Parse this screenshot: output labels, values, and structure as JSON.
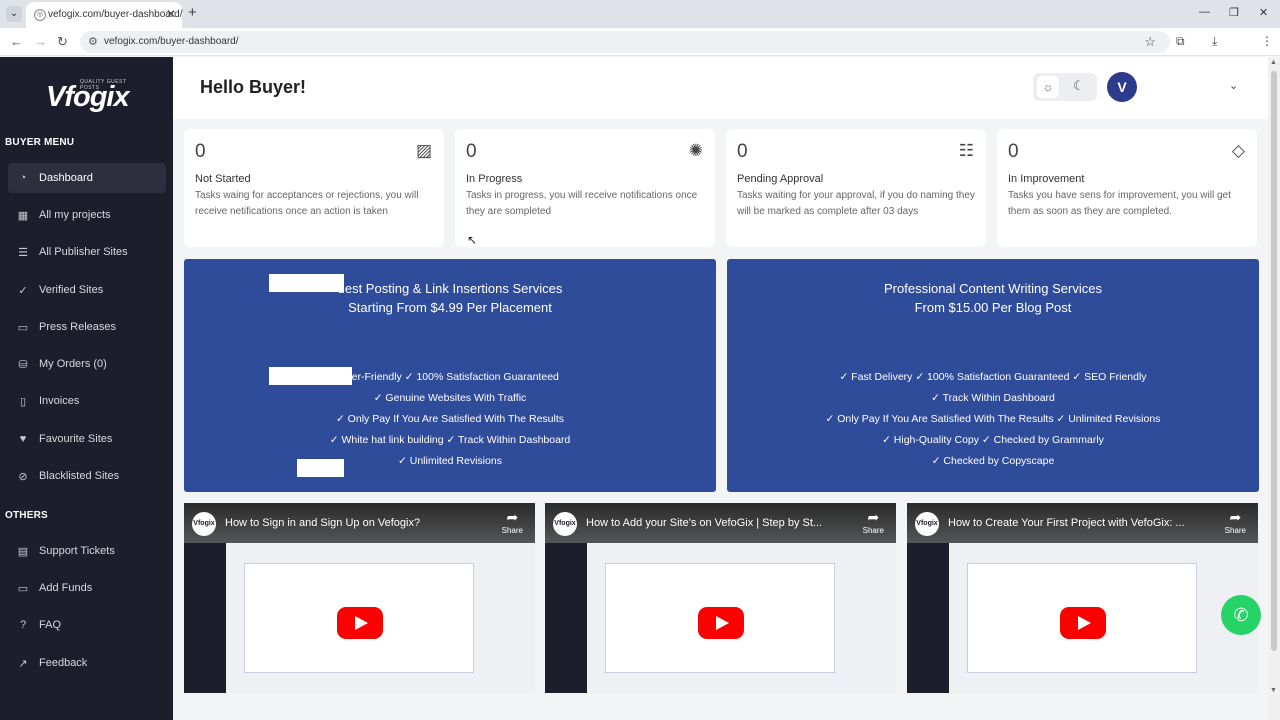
{
  "browser": {
    "tab_title": "vefogix.com/buyer-dashboard/",
    "url": "vefogix.com/buyer-dashboard/",
    "new_tab": "+",
    "close": "✕"
  },
  "logo": {
    "brand": "Vfogix",
    "tagline": "QUALITY GUEST POSTS"
  },
  "sidebar": {
    "buyer_heading": "BUYER MENU",
    "buyer_items": [
      {
        "label": "Dashboard",
        "icon": "◔"
      },
      {
        "label": "All my projects",
        "icon": "▦"
      },
      {
        "label": "All Publisher Sites",
        "icon": "☰"
      },
      {
        "label": "Verified Sites",
        "icon": "✓"
      },
      {
        "label": "Press Releases",
        "icon": "▭"
      },
      {
        "label": "My Orders (0)",
        "icon": "⛁"
      },
      {
        "label": "Invoices",
        "icon": "▯"
      },
      {
        "label": "Favourite Sites",
        "icon": "♥"
      },
      {
        "label": "Blacklisted Sites",
        "icon": "⊘"
      }
    ],
    "others_heading": "OTHERS",
    "other_items": [
      {
        "label": "Support Tickets",
        "icon": "▤"
      },
      {
        "label": "Add Funds",
        "icon": "▭"
      },
      {
        "label": "FAQ",
        "icon": "?"
      },
      {
        "label": "Feedback",
        "icon": "↗"
      }
    ]
  },
  "header": {
    "greeting": "Hello Buyer!",
    "avatar_initial": "V",
    "sun": "☼",
    "moon": "☾",
    "chevron": "⌄"
  },
  "stats": [
    {
      "count": "0",
      "label": "Not Started",
      "desc": "Tasks waing for acceptances or rejections, you will receive netifications once an action is taken",
      "icon": "▨"
    },
    {
      "count": "0",
      "label": "In Progress",
      "desc": "Tasks in progress, you will receive notifications once they are sompleted",
      "icon": "✺"
    },
    {
      "count": "0",
      "label": "Pending Approval",
      "desc": "Tasks waiting for your approval, if you do naming they will be marked as complete after 03 days",
      "icon": "☷"
    },
    {
      "count": "0",
      "label": "In Improvement",
      "desc": "Tasks you have sens for improvement, you will get them as soon as they are completed.",
      "icon": "◇"
    }
  ],
  "banners": [
    {
      "line1": "uest Posting & Link Insertions Services",
      "line2": "Starting From $4.99 Per Placement",
      "bullets": [
        "eller-Friendly ✓ 100% Satisfaction Guaranteed",
        "✓ Genuine Websites With Traffic",
        "✓ Only Pay If You Are Satisfied With The Results",
        "✓ White hat link building ✓ Track Within Dashboard",
        "✓ Unlimited Revisions"
      ]
    },
    {
      "line1": "Professional Content Writing Services",
      "line2": "From $15.00 Per Blog Post",
      "bullets": [
        "✓ Fast Delivery ✓ 100% Satisfaction Guaranteed ✓ SEO Friendly",
        "✓ Track Within Dashboard",
        "✓ Only Pay If You Are Satisfied With The Results ✓ Unlimited Revisions",
        "✓ High-Quality Copy ✓ Checked by Grammarly",
        "✓ Checked by Copyscape"
      ]
    }
  ],
  "videos": [
    {
      "title": "How to Sign in and Sign Up on Vefogix?",
      "share": "Share",
      "channel": "Vfogix"
    },
    {
      "title": "How to Add your Site's on VefoGix | Step by St...",
      "share": "Share",
      "channel": "Vfogix"
    },
    {
      "title": "How to Create Your First Project with VefoGix: ...",
      "share": "Share",
      "channel": "Vfogix"
    }
  ]
}
